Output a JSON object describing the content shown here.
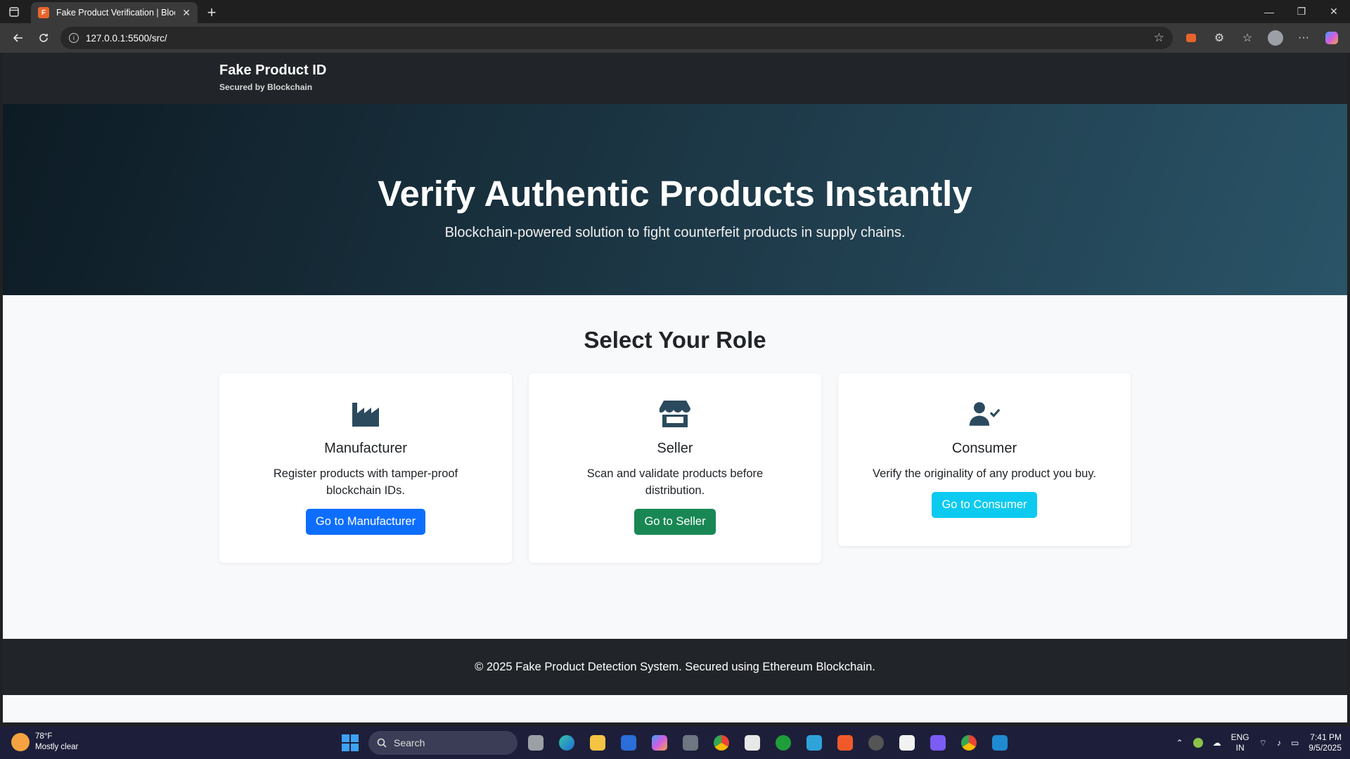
{
  "browser": {
    "tab_title": "Fake Product Verification | Blockchain",
    "tab_favicon": "F",
    "url": "127.0.0.1:5500/src/"
  },
  "header": {
    "brand_title": "Fake Product ID",
    "brand_subtitle": "Secured by Blockchain"
  },
  "hero": {
    "title": "Verify Authentic Products Instantly",
    "subtitle": "Blockchain-powered solution to fight counterfeit products in supply chains."
  },
  "roles": {
    "title": "Select Your Role",
    "cards": [
      {
        "icon": "factory-icon",
        "title": "Manufacturer",
        "description": "Register products with tamper-proof blockchain IDs.",
        "button": "Go to Manufacturer",
        "button_color": "#0d6efd"
      },
      {
        "icon": "store-icon",
        "title": "Seller",
        "description": "Scan and validate products before distribution.",
        "button": "Go to Seller",
        "button_color": "#198754"
      },
      {
        "icon": "user-check-icon",
        "title": "Consumer",
        "description": "Verify the originality of any product you buy.",
        "button": "Go to Consumer",
        "button_color": "#0dcaf0"
      }
    ]
  },
  "footer": {
    "text": "© 2025 Fake Product Detection System. Secured using Ethereum Blockchain."
  },
  "taskbar": {
    "weather_temp": "78°F",
    "weather_desc": "Mostly clear",
    "search_placeholder": "Search",
    "lang_line1": "ENG",
    "lang_line2": "IN",
    "time": "7:41 PM",
    "date": "9/5/2025"
  },
  "colors": {
    "header_bg": "#212529",
    "icon_color": "#2b4a5e"
  }
}
